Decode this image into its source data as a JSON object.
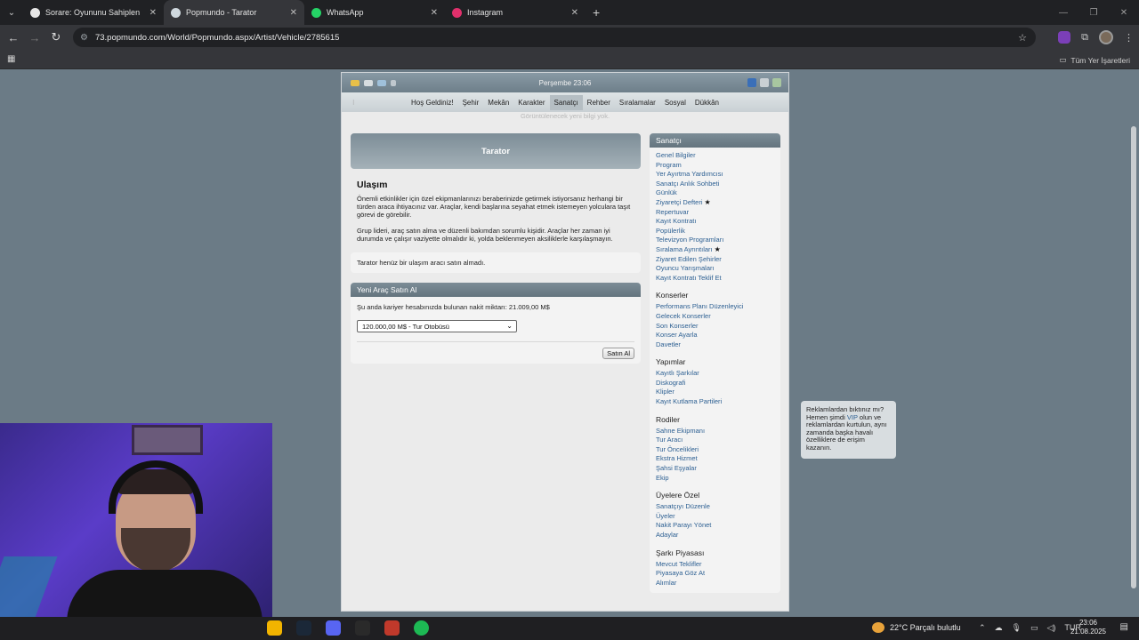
{
  "browser": {
    "tabs": [
      {
        "title": "Sorare: Oyununu Sahiplen",
        "icon": "sorare-icon",
        "active": false
      },
      {
        "title": "Popmundo - Tarator",
        "icon": "popmundo-icon",
        "active": true
      },
      {
        "title": "WhatsApp",
        "icon": "whatsapp-icon",
        "active": false
      },
      {
        "title": "Instagram",
        "icon": "instagram-icon",
        "active": false
      }
    ],
    "new_tab": "+",
    "url": "73.popmundo.com/World/Popmundo.aspx/Artist/Vehicle/2785615",
    "bookmarks_all": "Tüm Yer İşaretleri"
  },
  "game": {
    "datetime": "Perşembe 23:06",
    "nav": [
      "Hoş Geldiniz!",
      "Şehir",
      "Mekân",
      "Karakter",
      "Sanatçı",
      "Rehber",
      "Sıralamalar",
      "Sosyal",
      "Dükkân"
    ],
    "nav_active": "Sanatçı",
    "info_line": "Görüntülenecek yeni bilgi yok."
  },
  "main": {
    "artist_name": "Tarator",
    "section_title": "Ulaşım",
    "para1": "Önemli etkinlikler için özel ekipmanlarınızı beraberinizde getirmek istiyorsanız herhangi bir türden araca ihtiyacınız var. Araçlar, kendi başlarına seyahat etmek istemeyen yolculara taşıt görevi de görebilir.",
    "para2": "Grup lideri, araç satın alma ve düzenli bakımdan sorumlu kişidir. Araçlar her zaman iyi durumda ve çalışır vaziyette olmalıdır ki, yolda beklenmeyen aksiliklerle karşılaşmayın.",
    "notice": "Tarator henüz bir ulaşım aracı satın almadı.",
    "buy_title": "Yeni Araç Satın Al",
    "cash_text": "Şu anda kariyer hesabınızda bulunan nakit miktarı: 21.009,00 M$",
    "select_value": "120.000,00 M$ - Tur Otobüsü",
    "buy_button": "Satın Al"
  },
  "sidebar": {
    "header": "Sanatçı",
    "groups": [
      {
        "title": "",
        "links": [
          "Genel Bilgiler",
          "Program",
          "Yer Ayırtma Yardımcısı",
          "Sanatçı Anlık Sohbeti",
          "Günlük",
          "Ziyaretçi Defteri",
          "Repertuvar",
          "Kayıt Kontratı",
          "Popülerlik",
          "Televizyon Programları",
          "Sıralama Ayrıntıları",
          "Ziyaret Edilen Şehirler",
          "Oyuncu Yarışmaları",
          "Kayıt Kontratı Teklif Et"
        ]
      },
      {
        "title": "Konserler",
        "links": [
          "Performans Planı Düzenleyici",
          "Gelecek Konserler",
          "Son Konserler",
          "Konser Ayarla",
          "Davetler"
        ]
      },
      {
        "title": "Yapımlar",
        "links": [
          "Kayıtlı Şarkılar",
          "Diskografi",
          "Klipler",
          "Kayıt Kutlama Partileri"
        ]
      },
      {
        "title": "Rodiler",
        "links": [
          "Sahne Ekipmanı",
          "Tur Aracı",
          "Tur Öncelikleri",
          "Ekstra Hizmet",
          "Şahsi Eşyalar",
          "Ekip"
        ]
      },
      {
        "title": "Üyelere Özel",
        "links": [
          "Sanatçıyı Düzenle",
          "Üyeler",
          "Nakit Parayı Yönet",
          "Adaylar"
        ]
      },
      {
        "title": "Şarkı Piyasası",
        "links": [
          "Mevcut Teklifler",
          "Piyasaya Göz At",
          "Alımlar"
        ]
      }
    ],
    "starred": [
      "Ziyaretçi Defteri",
      "Sıralama Ayrıntıları"
    ]
  },
  "ad": {
    "text_before": "Reklamlardan bıktınız mı? Hemen şimdi",
    "vip": "VIP",
    "text_after": "olun ve reklamlardan kurtulun, aynı zamanda başka havalı özelliklere de erişim kazanın."
  },
  "taskbar": {
    "weather": "22°C  Parçalı bulutlu",
    "lang": "TUR",
    "time": "23:06",
    "date": "21.08.2025"
  }
}
